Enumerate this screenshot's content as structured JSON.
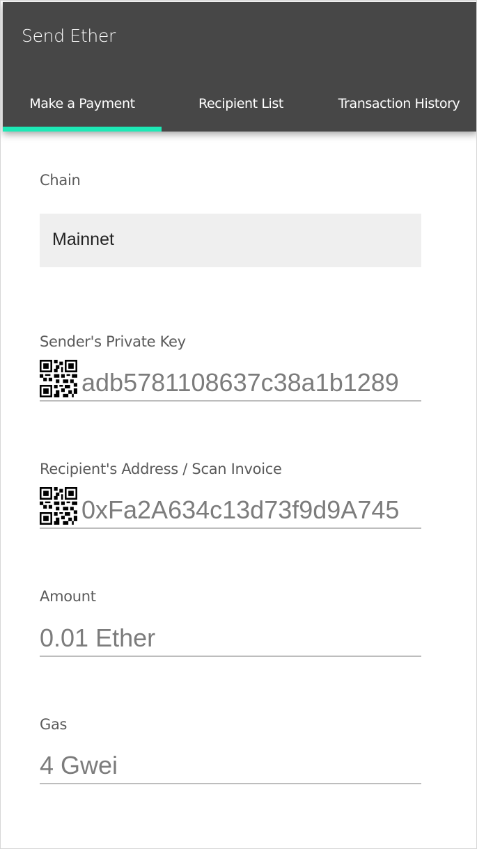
{
  "app": {
    "title": "Send Ether"
  },
  "tabs": [
    {
      "label": "Make a Payment",
      "active": true
    },
    {
      "label": "Recipient List",
      "active": false
    },
    {
      "label": "Transaction History",
      "active": false
    }
  ],
  "colors": {
    "app_bar": "#474747",
    "tab_indicator": "#1de9b6",
    "select_bg": "#efefef"
  },
  "form": {
    "chain": {
      "label": "Chain",
      "value": "Mainnet"
    },
    "private_key": {
      "label": "Sender's Private Key",
      "value": "adb5781108637c38a1b1289",
      "icon": "qr-code-icon"
    },
    "recipient": {
      "label": "Recipient's Address / Scan Invoice",
      "value": "0xFa2A634c13d73f9d9A745",
      "icon": "qr-code-icon"
    },
    "amount": {
      "label": "Amount",
      "value": "0.01 Ether"
    },
    "gas": {
      "label": "Gas",
      "value": "4 Gwei"
    }
  }
}
